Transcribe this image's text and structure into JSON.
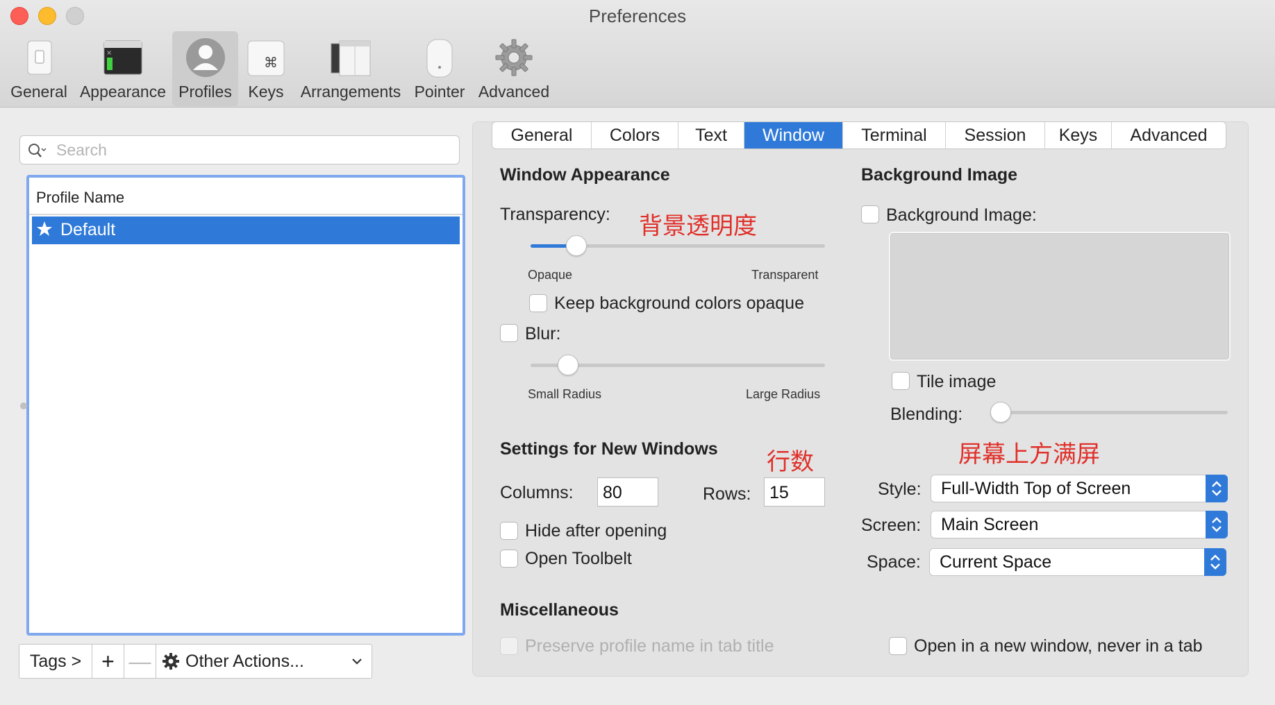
{
  "window": {
    "title": "Preferences"
  },
  "toolbar": {
    "items": [
      {
        "label": "General",
        "icon": "general-switch-icon"
      },
      {
        "label": "Appearance",
        "icon": "appearance-window-icon"
      },
      {
        "label": "Profiles",
        "icon": "profile-person-icon",
        "selected": true
      },
      {
        "label": "Keys",
        "icon": "command-key-icon"
      },
      {
        "label": "Arrangements",
        "icon": "arrangements-windows-icon"
      },
      {
        "label": "Pointer",
        "icon": "mouse-pointer-icon"
      },
      {
        "label": "Advanced",
        "icon": "gear-icon"
      }
    ]
  },
  "sidebar": {
    "search_placeholder": "Search",
    "list_header": "Profile Name",
    "profiles": [
      {
        "name": "Default",
        "selected": true,
        "icon": "star-icon"
      }
    ],
    "tags_label": "Tags >",
    "add_label": "+",
    "remove_label": "—",
    "other_actions_label": "Other Actions..."
  },
  "tabs": [
    {
      "label": "General"
    },
    {
      "label": "Colors"
    },
    {
      "label": "Text"
    },
    {
      "label": "Window",
      "active": true
    },
    {
      "label": "Terminal"
    },
    {
      "label": "Session"
    },
    {
      "label": "Keys"
    },
    {
      "label": "Advanced"
    }
  ],
  "window_appearance": {
    "heading": "Window Appearance",
    "transparency_label": "Transparency:",
    "transparency_annotation": "背景透明度",
    "transparency_value": 0.13,
    "opaque_label": "Opaque",
    "transparent_label": "Transparent",
    "keep_bg_opaque_label": "Keep background colors opaque",
    "keep_bg_opaque_checked": false,
    "blur_label": "Blur:",
    "blur_checked": false,
    "blur_value": 0.1,
    "small_radius_label": "Small Radius",
    "large_radius_label": "Large Radius"
  },
  "new_windows": {
    "heading": "Settings for New Windows",
    "rows_annotation": "行数",
    "columns_label": "Columns:",
    "columns_value": "80",
    "rows_label": "Rows:",
    "rows_value": "15",
    "hide_after_opening_label": "Hide after opening",
    "open_toolbelt_label": "Open Toolbelt"
  },
  "background_image": {
    "heading": "Background Image",
    "checkbox_label": "Background Image:",
    "tile_label": "Tile image",
    "blending_label": "Blending:",
    "blending_value": 0.0,
    "style_annotation": "屏幕上方满屏",
    "style_label": "Style:",
    "style_value": "Full-Width Top of Screen",
    "screen_label": "Screen:",
    "screen_value": "Main Screen",
    "space_label": "Space:",
    "space_value": "Current Space"
  },
  "misc": {
    "heading": "Miscellaneous",
    "preserve_name_label": "Preserve profile name in tab title",
    "preserve_name_disabled": true,
    "open_new_window_label": "Open in a new window, never in a tab"
  },
  "colors": {
    "accent": "#2f7ad9",
    "annotation_red": "#e0302a",
    "close": "#fd5f57",
    "minimize": "#fdbc2e"
  }
}
